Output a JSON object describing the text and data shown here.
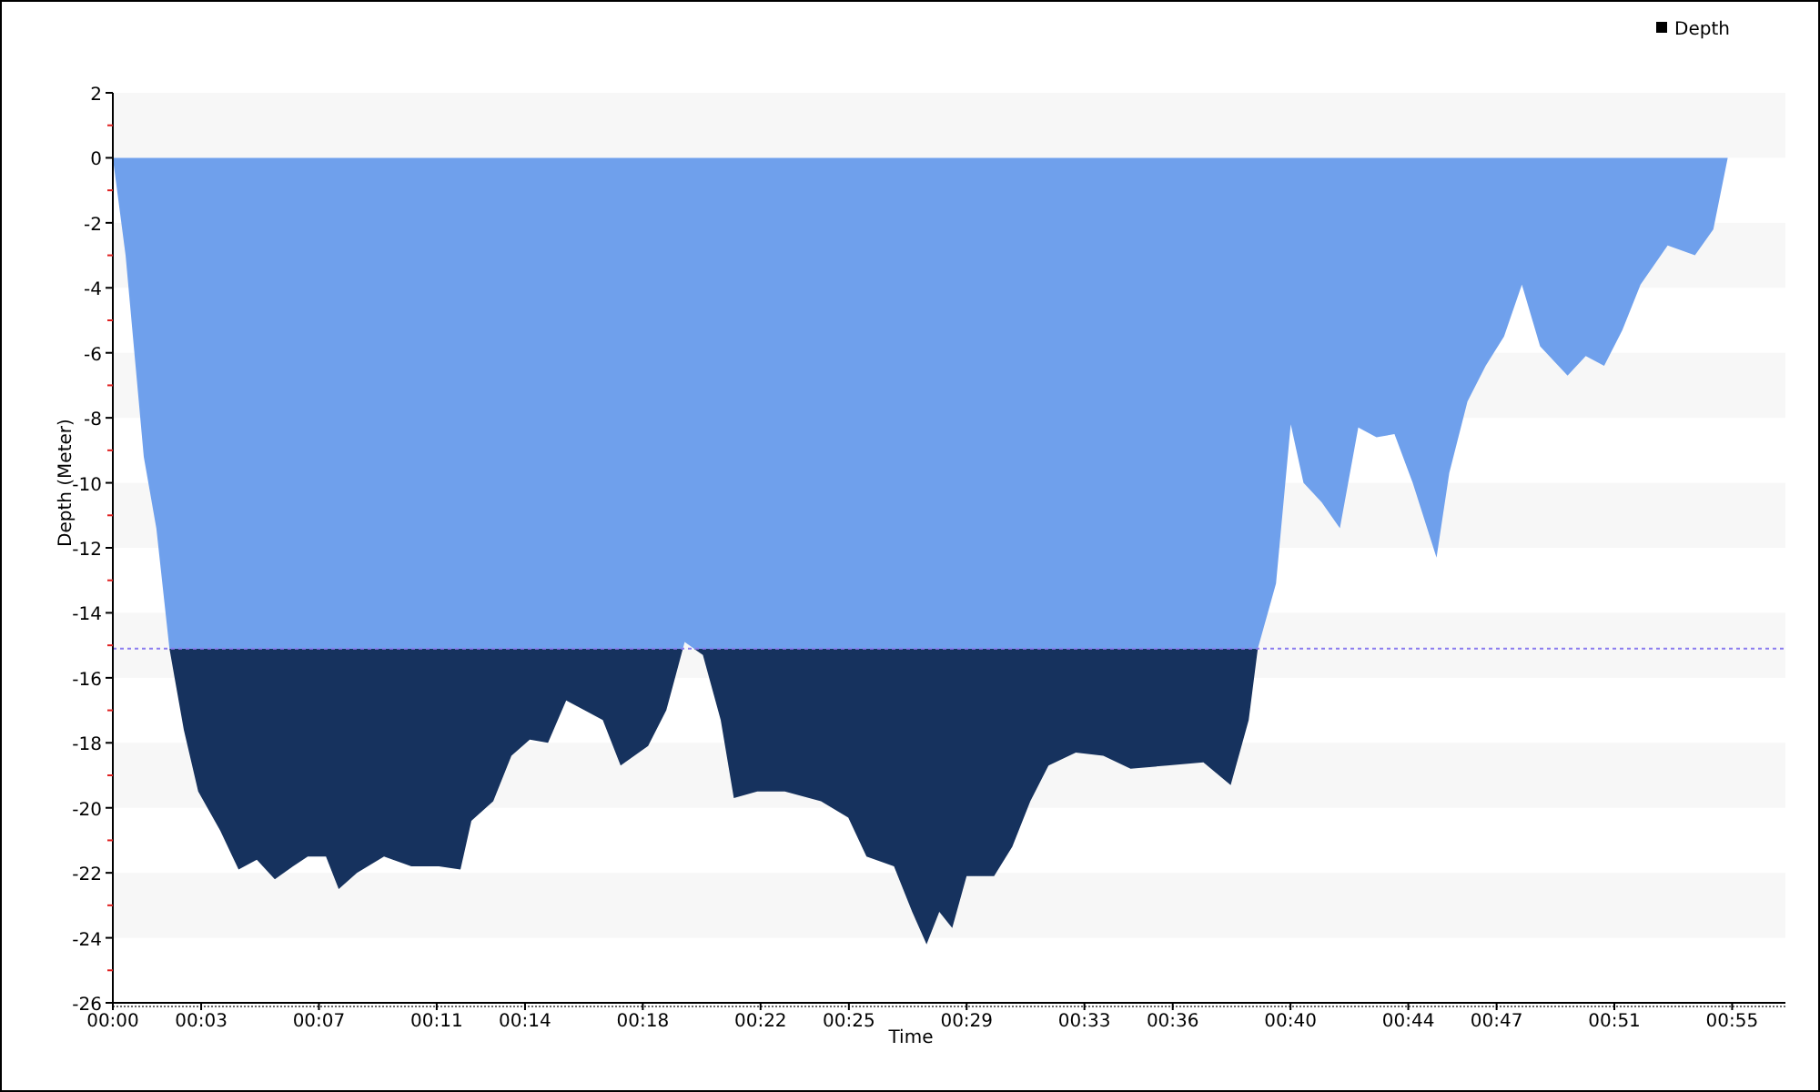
{
  "chart_data": {
    "type": "area",
    "xlabel": "Time",
    "ylabel": "Depth (Meter)",
    "x": [
      0,
      0.43,
      1.05,
      1.48,
      1.92,
      2.41,
      2.9,
      3.65,
      4.27,
      4.89,
      5.5,
      6.12,
      6.62,
      7.24,
      7.67,
      8.29,
      9.21,
      10.14,
      11.07,
      11.81,
      12.18,
      12.92,
      13.54,
      14.16,
      14.78,
      15.4,
      16.02,
      16.64,
      17.25,
      18.18,
      18.8,
      19.42,
      20.04,
      20.65,
      21.09,
      21.89,
      22.82,
      24.05,
      24.98,
      25.6,
      26.53,
      27.15,
      27.64,
      28.07,
      28.51,
      29.0,
      29.93,
      30.55,
      31.16,
      31.78,
      32.71,
      33.64,
      34.57,
      35.81,
      37.04,
      37.97,
      38.58,
      38.89,
      39.51,
      40.01,
      40.44,
      41.06,
      41.68,
      42.3,
      42.92,
      43.53,
      44.15,
      44.96,
      45.39,
      46.01,
      46.63,
      47.25,
      47.86,
      48.48,
      49.41,
      50.03,
      50.65,
      51.27,
      51.89,
      52.81,
      53.74,
      54.36,
      54.85
    ],
    "series": [
      {
        "name": "Depth",
        "color": "#6fa0ec",
        "values": [
          0,
          -3.0,
          -9.2,
          -11.4,
          -15.1,
          -17.6,
          -19.5,
          -20.7,
          -21.9,
          -21.6,
          -22.2,
          -21.8,
          -21.5,
          -21.5,
          -22.5,
          -22.0,
          -21.5,
          -21.8,
          -21.8,
          -21.9,
          -20.4,
          -19.8,
          -18.4,
          -17.9,
          -18.0,
          -16.7,
          -17.0,
          -17.3,
          -18.7,
          -18.1,
          -17.0,
          -14.9,
          -15.3,
          -17.3,
          -19.7,
          -19.5,
          -19.5,
          -19.8,
          -20.3,
          -21.5,
          -21.8,
          -23.2,
          -24.2,
          -23.2,
          -23.7,
          -22.1,
          -22.1,
          -21.2,
          -19.8,
          -18.7,
          -18.3,
          -18.4,
          -18.8,
          -18.7,
          -18.6,
          -19.3,
          -17.3,
          -15.1,
          -13.1,
          -8.2,
          -10.0,
          -10.6,
          -11.4,
          -8.3,
          -8.6,
          -8.5,
          -10.0,
          -12.3,
          -9.7,
          -7.5,
          -6.4,
          -5.5,
          -3.9,
          -5.8,
          -6.7,
          -6.1,
          -6.4,
          -5.3,
          -3.9,
          -2.7,
          -3.0,
          -2.2,
          0
        ]
      }
    ],
    "xlim": [
      0,
      56.81
    ],
    "ylim": [
      -26,
      2
    ],
    "xticks": [
      {
        "value": 0,
        "label": "00:00"
      },
      {
        "value": 3,
        "label": "00:03"
      },
      {
        "value": 7,
        "label": "00:07"
      },
      {
        "value": 11,
        "label": "00:11"
      },
      {
        "value": 14,
        "label": "00:14"
      },
      {
        "value": 18,
        "label": "00:18"
      },
      {
        "value": 22,
        "label": "00:22"
      },
      {
        "value": 25,
        "label": "00:25"
      },
      {
        "value": 29,
        "label": "00:29"
      },
      {
        "value": 33,
        "label": "00:33"
      },
      {
        "value": 36,
        "label": "00:36"
      },
      {
        "value": 40,
        "label": "00:40"
      },
      {
        "value": 44,
        "label": "00:44"
      },
      {
        "value": 47,
        "label": "00:47"
      },
      {
        "value": 51,
        "label": "00:51"
      },
      {
        "value": 55,
        "label": "00:55"
      }
    ],
    "yticks": [
      2,
      0,
      -2,
      -4,
      -6,
      -8,
      -10,
      -12,
      -14,
      -16,
      -18,
      -20,
      -22,
      -24,
      -26
    ],
    "ref_lines": [
      {
        "axis": "y",
        "value": -15.1,
        "color": "#8a7cf0"
      }
    ]
  }
}
